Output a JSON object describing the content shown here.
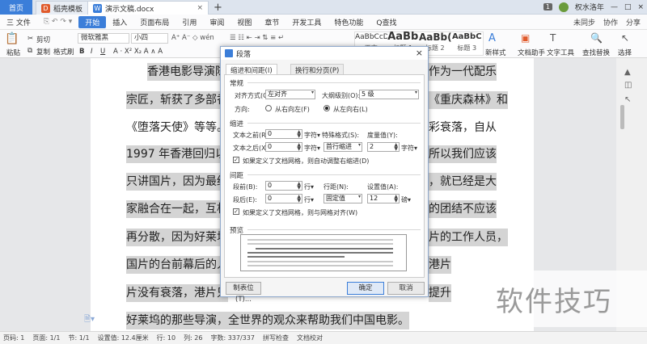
{
  "titlebar": {
    "home": "首页",
    "tabs": [
      {
        "label": "稻壳模板"
      },
      {
        "label": "演示文稿.docx"
      }
    ],
    "plus": "+",
    "badge": "1",
    "user": "权水洛年",
    "controls": [
      "—",
      "□",
      "×"
    ]
  },
  "menubar": {
    "file": "三 文件",
    "start": "开始",
    "items": [
      "插入",
      "页面布局",
      "引用",
      "审阅",
      "视图",
      "章节",
      "开发工具",
      "特色功能"
    ],
    "search": "Q查找",
    "right": [
      "未同步",
      "协作",
      "分享"
    ]
  },
  "ribbon": {
    "cut": "剪切",
    "copy": "复制",
    "paste": "粘贴",
    "format_painter": "格式刷",
    "font": "微软雅黑",
    "size": "小四",
    "styles": [
      {
        "sample": "AaBbCcDd",
        "name": "正文"
      },
      {
        "sample": "AaBb",
        "name": "标题 1"
      },
      {
        "sample": "AaBb(",
        "name": "标题 2"
      },
      {
        "sample": "AaBbC",
        "name": "标题 3"
      }
    ],
    "new_style": "新样式",
    "assistant": "文档助手",
    "text_tools": "文字工具",
    "find_replace": "查找替换",
    "select": "选择"
  },
  "document": {
    "lines": [
      "香港电影导演陈",
      "宗匠，斩获了多部香",
      "《堕落天使》等等。",
      "1997 年香港回归以",
      "只讲国片，因为最终",
      "家融合在一起，互相",
      "再分散，因为好莱坞",
      "国片的台前幕后的人",
      "片没有衰落，港片只",
      "好莱坞的那些导演，全世界的观众来帮助我们中国电影。"
    ],
    "right_fragments": [
      "作为一代配乐",
      "《重庆森林》和",
      "彩衰落，自从",
      "所以我们应该",
      "，就已经是大",
      "的团结不应该",
      "片的工作人员，",
      "港片",
      "提升"
    ]
  },
  "watermark": "软件技巧",
  "status": [
    "页码: 1",
    "页面: 1/1",
    "节: 1/1",
    "设置值: 12.4厘米",
    "行: 10",
    "列: 26",
    "字数: 337/337",
    "拼写检查",
    "文档校对"
  ],
  "dialog": {
    "title": "段落",
    "close": "×",
    "tabs": [
      "缩进和间距(I)",
      "换行和分页(P)"
    ],
    "general": {
      "heading": "常规",
      "align_label": "对齐方式(G):",
      "align_value": "左对齐",
      "outline_label": "大纲级别(O):",
      "outline_value": "5 级",
      "direction_label": "方向:",
      "rtl": "从右向左(F)",
      "ltr": "从左向右(L)"
    },
    "indent": {
      "heading": "缩进",
      "before_label": "文本之前(R):",
      "before_value": "0",
      "before_unit": "字符▾",
      "special_label": "特殊格式(S):",
      "special_value": "首行缩进",
      "measure_label": "度量值(Y):",
      "measure_value": "2",
      "measure_unit": "字符▾",
      "after_label": "文本之后(X):",
      "after_value": "0",
      "after_unit": "字符▾",
      "grid_check": "如果定义了文档网格，则自动调整右缩进(D)"
    },
    "spacing": {
      "heading": "间距",
      "before_label": "段前(B):",
      "before_value": "0",
      "before_unit": "行▾",
      "line_label": "行距(N):",
      "line_value": "固定值",
      "set_label": "设置值(A):",
      "set_value": "12",
      "set_unit": "磅▾",
      "after_label": "段后(E):",
      "after_value": "0",
      "after_unit": "行▾",
      "grid_check": "如果定义了文档网格，则与网格对齐(W)"
    },
    "preview": {
      "heading": "预览"
    },
    "buttons": {
      "tabs": "制表位(T)...",
      "ok": "确定",
      "cancel": "取消"
    }
  },
  "colors": {
    "accent": "#3b7ed9",
    "highlight": "#d4d4d4"
  }
}
